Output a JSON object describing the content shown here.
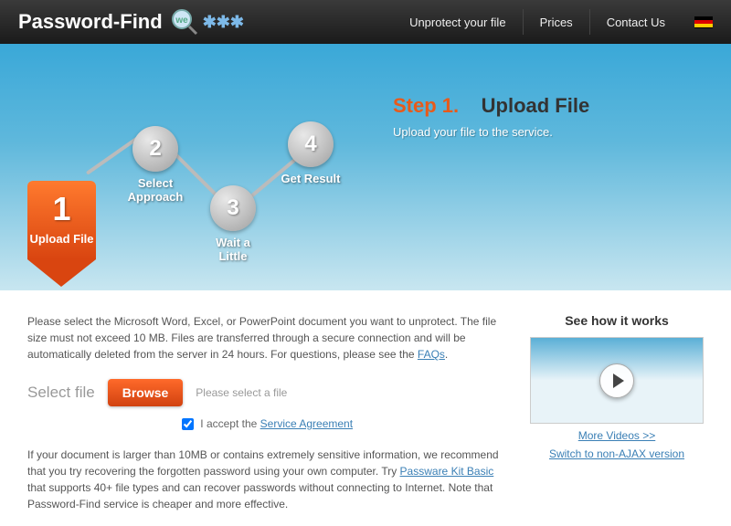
{
  "header": {
    "logo": "Password-Find",
    "logo_we": "we",
    "nav": {
      "unprotect": "Unprotect your file",
      "prices": "Prices",
      "contact": "Contact Us"
    }
  },
  "steps": {
    "s1": {
      "num": "1",
      "label": "Upload File"
    },
    "s2": {
      "num": "2",
      "label": "Select Approach"
    },
    "s3": {
      "num": "3",
      "label": "Wait a Little"
    },
    "s4": {
      "num": "4",
      "label": "Get Result"
    }
  },
  "hero": {
    "step_prefix": "Step 1.",
    "step_title": "Upload File",
    "subtitle": "Upload your file to the service."
  },
  "main": {
    "intro": "Please select the Microsoft Word, Excel, or PowerPoint document you want to unprotect. The file size must not exceed 10 MB. Files are transferred through a secure connection and will be automatically deleted from the server in 24 hours. For questions, please see the ",
    "faqs": "FAQs",
    "select_label": "Select file",
    "browse": "Browse",
    "hint": "Please select a file",
    "accept_prefix": "I accept the ",
    "accept_link": "Service Agreement",
    "rec_p1": "If your document is larger than 10MB or contains extremely sensitive information, we recommend that you try recovering the forgotten password using your own computer. Try ",
    "rec_link": "Passware Kit Basic",
    "rec_p2": " that supports 40+ file types and can recover passwords without connecting to Internet. Note that Password-Find service is cheaper and more effective."
  },
  "sidebar": {
    "title": "See how it works",
    "more": "More Videos >>",
    "switch": "Switch to non-AJAX version"
  }
}
